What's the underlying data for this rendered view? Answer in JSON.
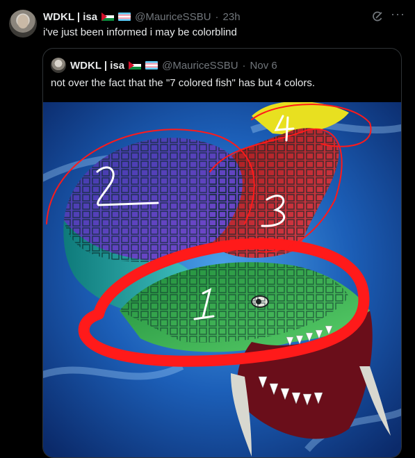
{
  "post": {
    "display_name": "WDKL | isa",
    "handle": "@MauriceSSBU",
    "separator": "·",
    "time": "23h",
    "text": "i've just been informed i may be colorblind",
    "grok_icon": "grok-icon",
    "more_icon": "more-icon",
    "more_label": "···"
  },
  "quote": {
    "display_name": "WDKL | isa",
    "handle": "@MauriceSSBU",
    "separator": "·",
    "time": "Nov 6",
    "text": "not over the fact that the \"7 colored fish\" has but 4 colors.",
    "image": {
      "annotations": [
        "1",
        "2",
        "3",
        "4"
      ]
    }
  },
  "colors": {
    "background": "#000000",
    "text": "#e7e9ea",
    "muted": "#71767b",
    "border": "#2f3336",
    "annotation_red": "#ff1a1a"
  }
}
